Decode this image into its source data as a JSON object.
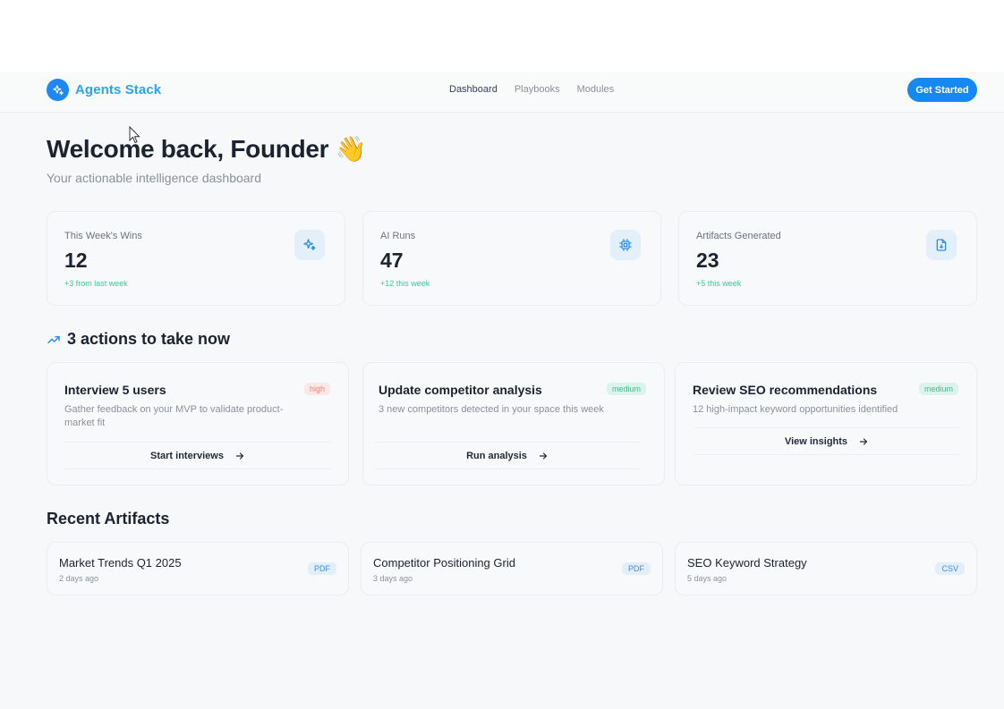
{
  "brand": {
    "name": "Agents Stack",
    "logo_icon": "sparkles-icon",
    "color": "#1e88f5"
  },
  "nav": {
    "items": [
      {
        "label": "Dashboard",
        "active": true
      },
      {
        "label": "Playbooks",
        "active": false
      },
      {
        "label": "Modules",
        "active": false
      }
    ]
  },
  "cta": {
    "label": "Get Started"
  },
  "hero": {
    "title": "Welcome back, Founder",
    "emoji": "👋",
    "subtitle": "Your actionable intelligence dashboard"
  },
  "stats": [
    {
      "label": "This Week's Wins",
      "value": "12",
      "change": "+3 from last week",
      "icon": "sparkles-icon"
    },
    {
      "label": "AI Runs",
      "value": "47",
      "change": "+12 this week",
      "icon": "cpu-icon"
    },
    {
      "label": "Artifacts Generated",
      "value": "23",
      "change": "+5 this week",
      "icon": "file-icon"
    }
  ],
  "actions_section": {
    "title": "3 actions to take now",
    "icon": "trending-up-icon"
  },
  "actions": [
    {
      "title": "Interview 5 users",
      "priority": "high",
      "desc": "Gather feedback on your MVP to validate product-market fit",
      "button": "Start interviews"
    },
    {
      "title": "Update competitor analysis",
      "priority": "medium",
      "desc": "3 new competitors detected in your space this week",
      "button": "Run analysis"
    },
    {
      "title": "Review SEO recommendations",
      "priority": "medium",
      "desc": "12 high-impact keyword opportunities identified",
      "button": "View insights"
    }
  ],
  "artifacts_section": {
    "title": "Recent Artifacts"
  },
  "artifacts": [
    {
      "name": "Market Trends Q1 2025",
      "date": "2 days ago",
      "type": "PDF"
    },
    {
      "name": "Competitor Positioning Grid",
      "date": "3 days ago",
      "type": "PDF"
    },
    {
      "name": "SEO Keyword Strategy",
      "date": "5 days ago",
      "type": "CSV"
    }
  ],
  "colors": {
    "accent": "#1589f0",
    "positive": "#3ec79a",
    "high": "#e7867a",
    "medium": "#3fbf8f"
  }
}
